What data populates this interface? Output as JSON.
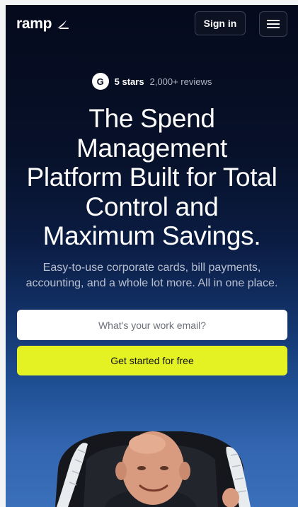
{
  "nav": {
    "logo_text": "ramp",
    "sign_in": "Sign in",
    "menu_icon": "hamburger-menu-icon"
  },
  "rating": {
    "badge": "G",
    "stars": "5 stars",
    "reviews": "2,000+ reviews"
  },
  "hero": {
    "headline_lines": [
      "The Spend",
      "Management",
      "Platform Built for Total",
      "Control and",
      "Maximum Savings."
    ],
    "subheading_lines": [
      "Easy-to-use corporate cards, bill payments,",
      "accounting, and a whole lot more. All in one place."
    ],
    "email_placeholder": "What's your work email?",
    "cta_label": "Get started for free"
  },
  "colors": {
    "cta": "#e4f223",
    "background_top": "#050a1c",
    "background_bottom": "#3a6fba"
  }
}
